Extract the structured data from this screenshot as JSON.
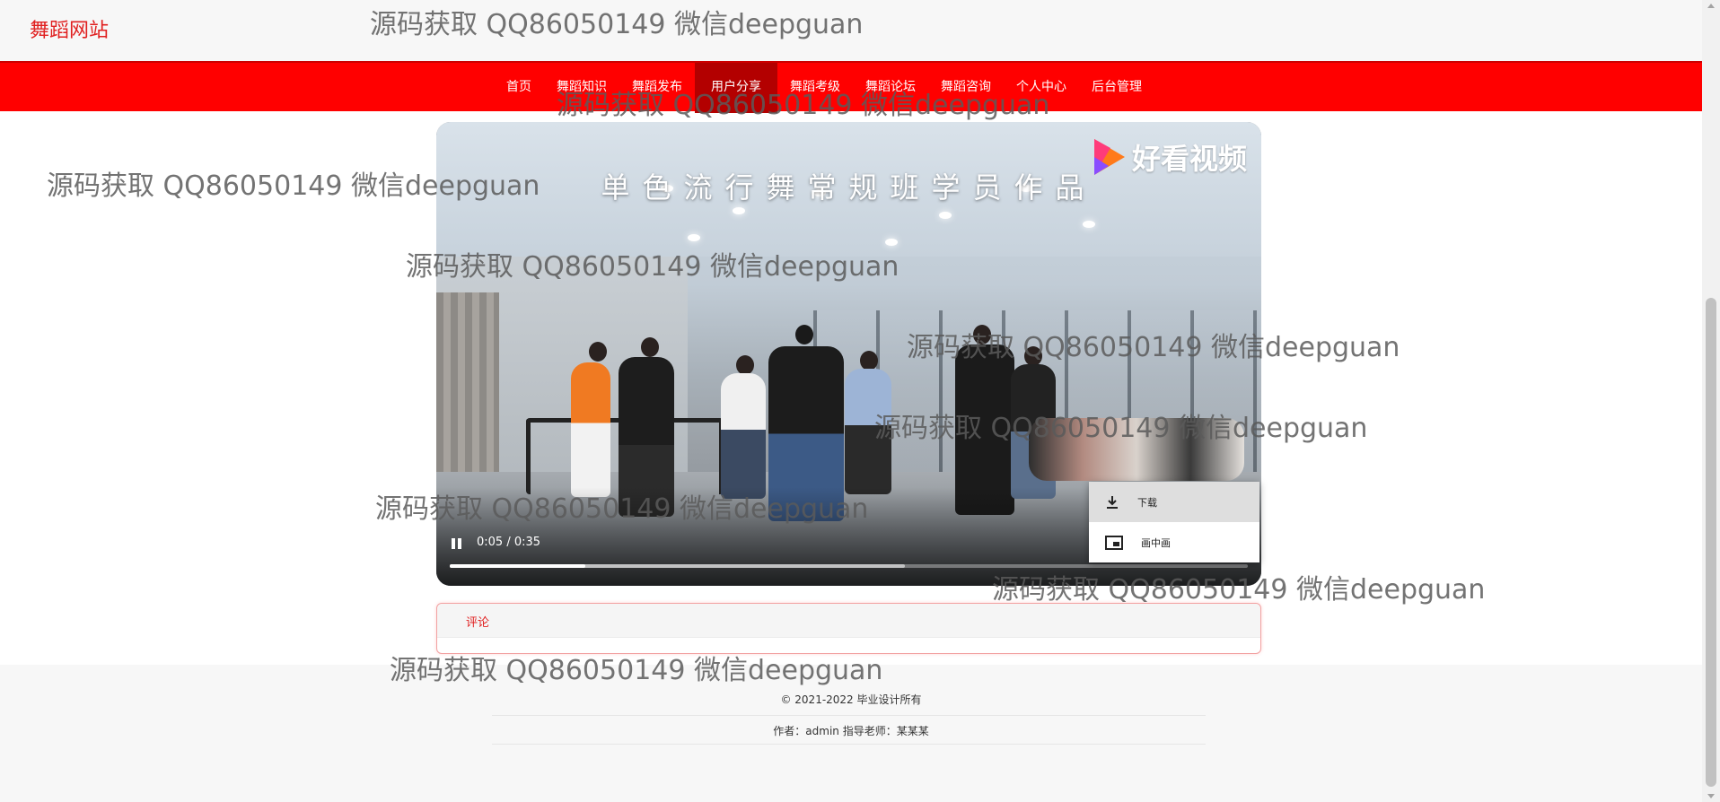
{
  "site": {
    "brand": "舞蹈网站"
  },
  "nav": {
    "items": [
      "首页",
      "舞蹈知识",
      "舞蹈发布",
      "用户分享",
      "舞蹈考级",
      "舞蹈论坛",
      "舞蹈咨询",
      "个人中心",
      "后台管理"
    ],
    "active": "用户分享"
  },
  "video": {
    "title": "单色流行舞常规班学员作品",
    "logo_text": "好看视频",
    "time": "0:05 / 0:35",
    "progress": 0.17,
    "buffered": 0.57,
    "state": "playing"
  },
  "context_menu": {
    "items": [
      {
        "label": "下载",
        "icon": "download-icon"
      },
      {
        "label": "画中画",
        "icon": "picture-in-picture-icon"
      }
    ]
  },
  "comments": {
    "tab_label": "评论"
  },
  "footer": {
    "copyright": "© 2021-2022 毕业设计所有",
    "credits": "作者：admin 指导老师：某某某"
  },
  "watermark": "源码获取 QQ86050149 微信deepguan",
  "colors": {
    "accent": "#ff0000",
    "nav_active": "#b30000",
    "brand": "#e02020"
  }
}
